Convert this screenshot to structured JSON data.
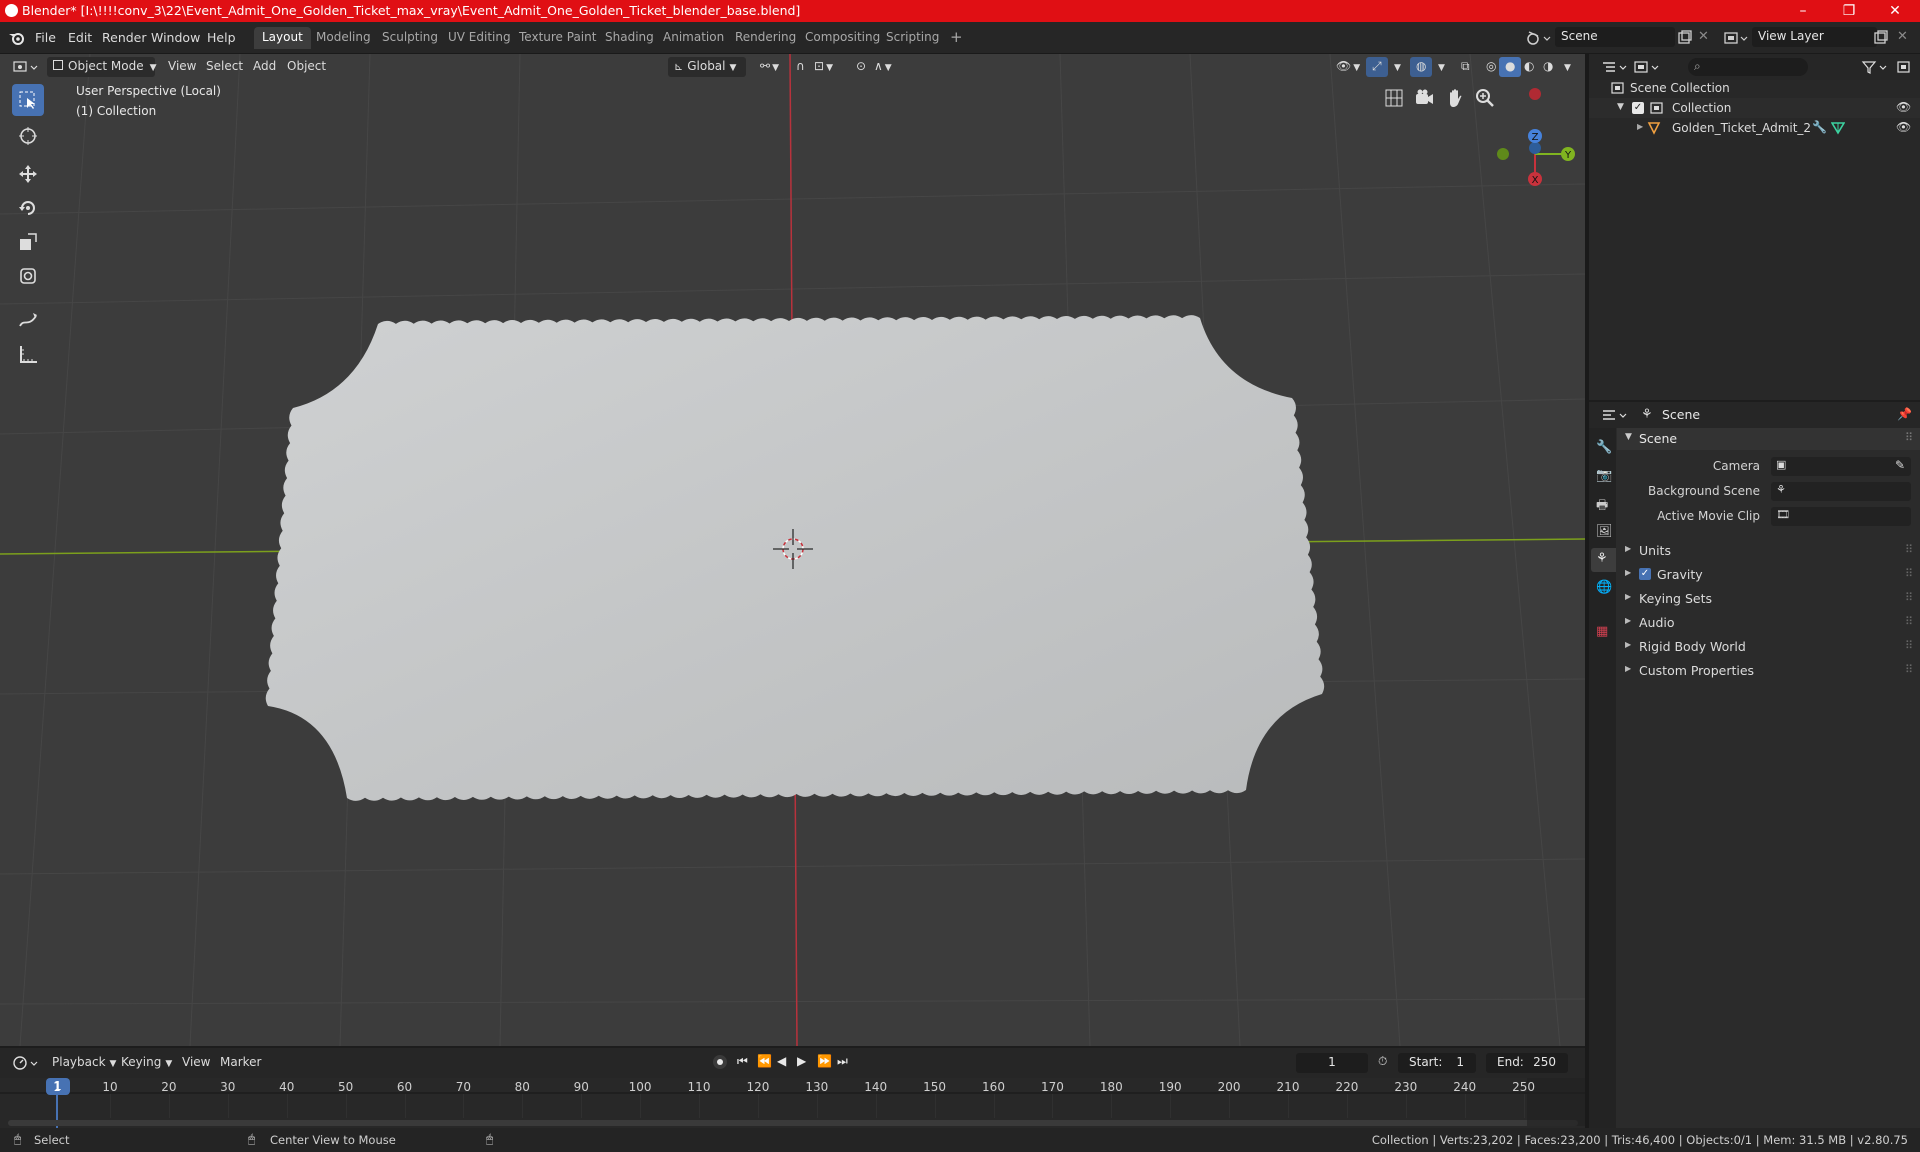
{
  "titlebar": {
    "title": "Blender* [I:\\!!!!conv_3\\22\\Event_Admit_One_Golden_Ticket_max_vray\\Event_Admit_One_Golden_Ticket_blender_base.blend]",
    "minimize": "–",
    "maximize": "❐",
    "close": "✕"
  },
  "menu": {
    "file": "File",
    "edit": "Edit",
    "render": "Render",
    "window": "Window",
    "help": "Help"
  },
  "workspaces": [
    "Layout",
    "Modeling",
    "Sculpting",
    "UV Editing",
    "Texture Paint",
    "Shading",
    "Animation",
    "Rendering",
    "Compositing",
    "Scripting",
    "+"
  ],
  "scene_field": "Scene",
  "view_layer_field": "View Layer",
  "viewport_header": {
    "mode": "Object Mode",
    "view": "View",
    "select": "Select",
    "add": "Add",
    "object": "Object",
    "orientation": "Global"
  },
  "viewport_overlay": {
    "perspective": "User Perspective (Local)",
    "collection": "(1) Collection"
  },
  "gizmo": {
    "z": "Z",
    "y": "Y",
    "x": "X"
  },
  "outliner": {
    "search_placeholder": "",
    "scene_collection": "Scene Collection",
    "collection": "Collection",
    "object": "Golden_Ticket_Admit_2"
  },
  "properties": {
    "context": "Scene",
    "panel_scene": "Scene",
    "camera_label": "Camera",
    "background_scene_label": "Background Scene",
    "active_movie_clip_label": "Active Movie Clip",
    "panels": [
      {
        "label": "Units",
        "checkbox": false
      },
      {
        "label": "Gravity",
        "checkbox": true
      },
      {
        "label": "Keying Sets",
        "checkbox": false
      },
      {
        "label": "Audio",
        "checkbox": false
      },
      {
        "label": "Rigid Body World",
        "checkbox": false
      },
      {
        "label": "Custom Properties",
        "checkbox": false
      }
    ]
  },
  "timeline": {
    "playback": "Playback",
    "keying": "Keying",
    "view": "View",
    "marker": "Marker",
    "current_frame": "1",
    "start_label": "Start:",
    "start": "1",
    "end_label": "End:",
    "end": "250",
    "ticks": [
      "1",
      "10",
      "20",
      "30",
      "40",
      "50",
      "60",
      "70",
      "80",
      "90",
      "100",
      "110",
      "120",
      "130",
      "140",
      "150",
      "160",
      "170",
      "180",
      "190",
      "200",
      "210",
      "220",
      "230",
      "240",
      "250"
    ]
  },
  "statusbar": {
    "select": "Select",
    "center_view": "Center View to Mouse",
    "stats": "Collection | Verts:23,202 | Faces:23,200 | Tris:46,400 | Objects:0/1 | Mem: 31.5 MB | v2.80.75"
  },
  "colors": {
    "title_red": "#e00f14",
    "accent_blue": "#4772b3",
    "axis_red": "#c8323c",
    "axis_green": "#80b420",
    "axis_blue": "#4682dc",
    "ticket": "#c4c6c7"
  }
}
